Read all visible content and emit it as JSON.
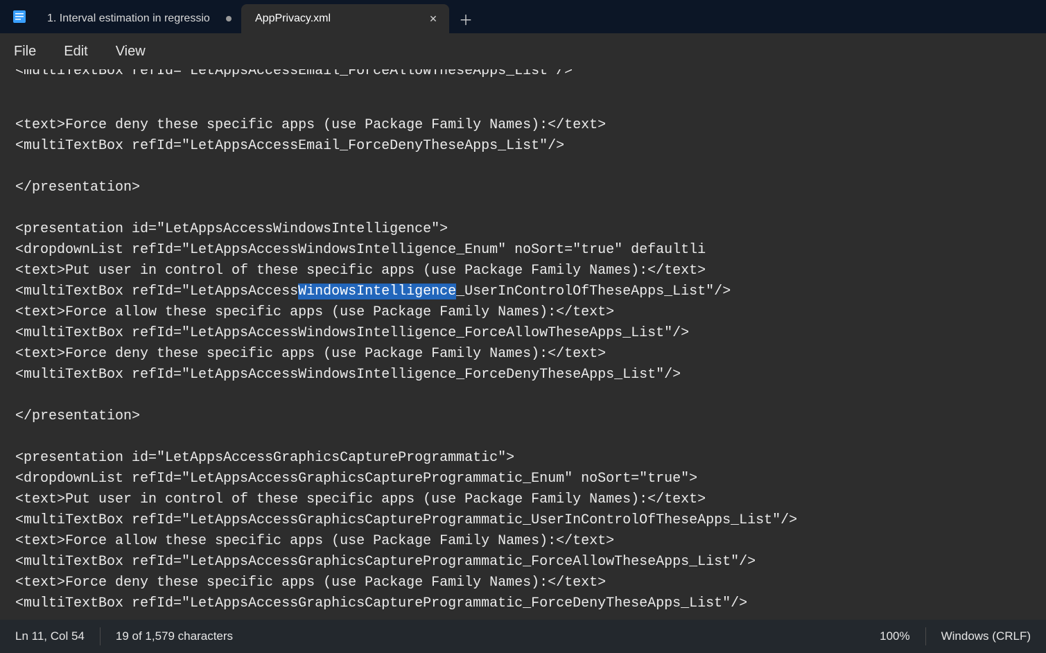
{
  "tabs": [
    {
      "title": "1. Interval estimation in regressio",
      "modified": true,
      "active": false
    },
    {
      "title": "AppPrivacy.xml",
      "modified": false,
      "active": true
    }
  ],
  "menu": {
    "file": "File",
    "edit": "Edit",
    "view": "View"
  },
  "editor": {
    "cutoff": "<multiTextBox refId=\"LetAppsAccessEmail_ForceAllowTheseApps_List\"/>",
    "lines": [
      "<text>Force deny these specific apps (use Package Family Names):</text>",
      "<multiTextBox refId=\"LetAppsAccessEmail_ForceDenyTheseApps_List\"/>",
      "",
      "</presentation>",
      "",
      "<presentation id=\"LetAppsAccessWindowsIntelligence\">",
      "<dropdownList refId=\"LetAppsAccessWindowsIntelligence_Enum\" noSort=\"true\" defaultli",
      "<text>Put user in control of these specific apps (use Package Family Names):</text>",
      {
        "pre": "<multiTextBox refId=\"LetAppsAccess",
        "sel": "WindowsIntelligence",
        "post": "_UserInControlOfTheseApps_List\"/>"
      },
      "<text>Force allow these specific apps (use Package Family Names):</text>",
      "<multiTextBox refId=\"LetAppsAccessWindowsIntelligence_ForceAllowTheseApps_List\"/>",
      "<text>Force deny these specific apps (use Package Family Names):</text>",
      "<multiTextBox refId=\"LetAppsAccessWindowsIntelligence_ForceDenyTheseApps_List\"/>",
      "",
      "</presentation>",
      "",
      "<presentation id=\"LetAppsAccessGraphicsCaptureProgrammatic\">",
      "<dropdownList refId=\"LetAppsAccessGraphicsCaptureProgrammatic_Enum\" noSort=\"true\">",
      "<text>Put user in control of these specific apps (use Package Family Names):</text>",
      "<multiTextBox refId=\"LetAppsAccessGraphicsCaptureProgrammatic_UserInControlOfTheseApps_List\"/>",
      "<text>Force allow these specific apps (use Package Family Names):</text>",
      "<multiTextBox refId=\"LetAppsAccessGraphicsCaptureProgrammatic_ForceAllowTheseApps_List\"/>",
      "<text>Force deny these specific apps (use Package Family Names):</text>",
      "<multiTextBox refId=\"LetAppsAccessGraphicsCaptureProgrammatic_ForceDenyTheseApps_List\"/>"
    ]
  },
  "status": {
    "position": "Ln 11, Col 54",
    "selection": "19 of 1,579 characters",
    "zoom": "100%",
    "encoding": "Windows (CRLF)"
  }
}
